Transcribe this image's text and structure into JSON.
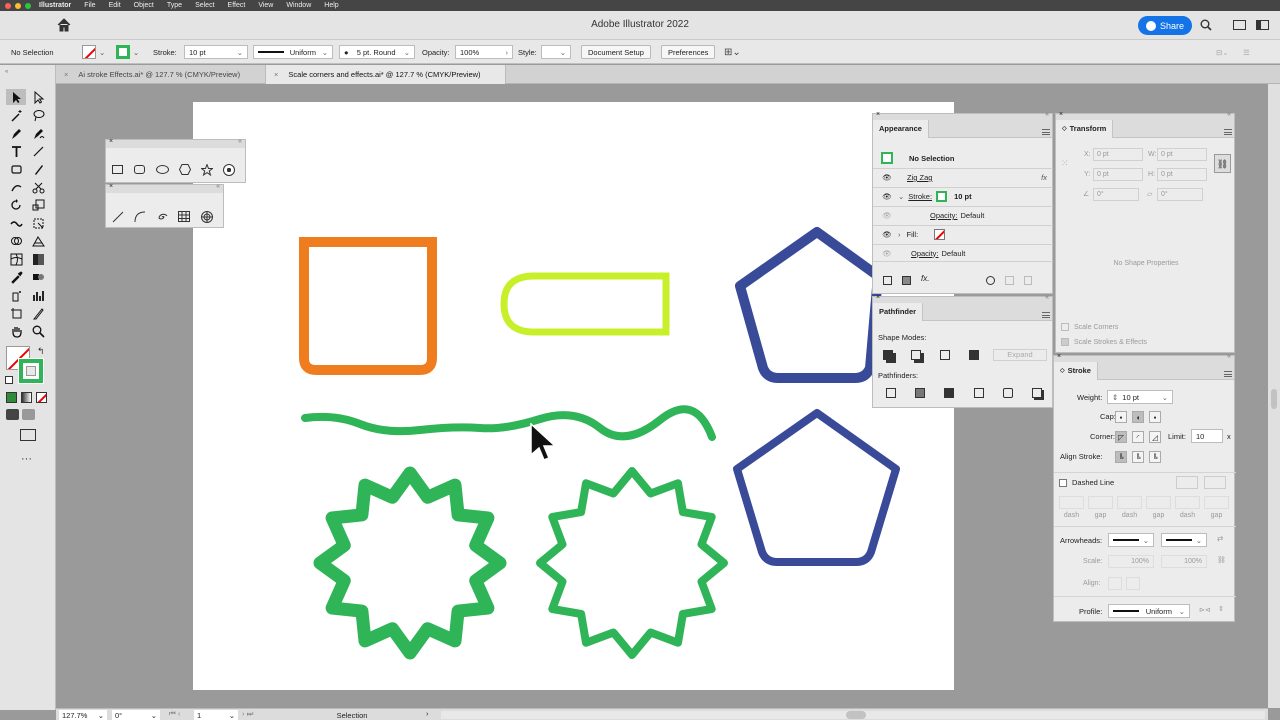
{
  "menubar": {
    "app": "Illustrator",
    "items": [
      "File",
      "Edit",
      "Object",
      "Type",
      "Select",
      "Effect",
      "View",
      "Window",
      "Help"
    ]
  },
  "title": "Adobe Illustrator 2022",
  "share_label": "Share",
  "control": {
    "selection": "No Selection",
    "stroke_label": "Stroke:",
    "stroke_value": "10 pt",
    "profile": "Uniform",
    "brush": "5 pt. Round",
    "opacity_label": "Opacity:",
    "opacity_value": "100%",
    "style_label": "Style:",
    "doc_setup": "Document Setup",
    "preferences": "Preferences"
  },
  "tabs": [
    {
      "label": "Ai stroke Effects.ai* @ 127.7 % (CMYK/Preview)"
    },
    {
      "label": "Scale corners and effects.ai* @ 127.7 % (CMYK/Preview)"
    }
  ],
  "appearance": {
    "title": "Appearance",
    "header": "No Selection",
    "effect": "Zig Zag",
    "stroke_label": "Stroke:",
    "stroke_value": "10 pt",
    "opacity_label": "Opacity:",
    "opacity_value": "Default",
    "fill_label": "Fill:",
    "opacity2_label": "Opacity:",
    "opacity2_value": "Default"
  },
  "pathfinder": {
    "title": "Pathfinder",
    "shape_modes": "Shape Modes:",
    "expand": "Expand",
    "pathfinders": "Pathfinders:"
  },
  "transform": {
    "title": "Transform",
    "x_label": "X:",
    "x_value": "0 pt",
    "y_label": "Y:",
    "y_value": "0 pt",
    "w_label": "W:",
    "w_value": "0 pt",
    "h_label": "H:",
    "h_value": "0 pt",
    "rot_value": "0°",
    "shear_value": "0°",
    "no_props": "No Shape Properties",
    "scale_corners": "Scale Corners",
    "scale_strokes": "Scale Strokes & Effects"
  },
  "strokepanel": {
    "title": "Stroke",
    "weight_label": "Weight:",
    "weight_value": "10 pt",
    "cap_label": "Cap:",
    "corner_label": "Corner:",
    "limit_label": "Limit:",
    "limit_value": "10",
    "limit_unit": "x",
    "align_label": "Align Stroke:",
    "dashed_label": "Dashed Line",
    "dash_labels": [
      "dash",
      "gap",
      "dash",
      "gap",
      "dash",
      "gap"
    ],
    "arrowheads_label": "Arrowheads:",
    "scale_label": "Scale:",
    "scale1": "100%",
    "scale2": "100%",
    "align2_label": "Align:",
    "profile_label": "Profile:",
    "profile_value": "Uniform"
  },
  "status": {
    "zoom": "127.7%",
    "rotation": "0°",
    "artboard": "1",
    "tool": "Selection"
  },
  "colors": {
    "orange": "#ef7c1f",
    "lime": "#c8f02a",
    "blue": "#394a98",
    "green": "#2fb457"
  }
}
